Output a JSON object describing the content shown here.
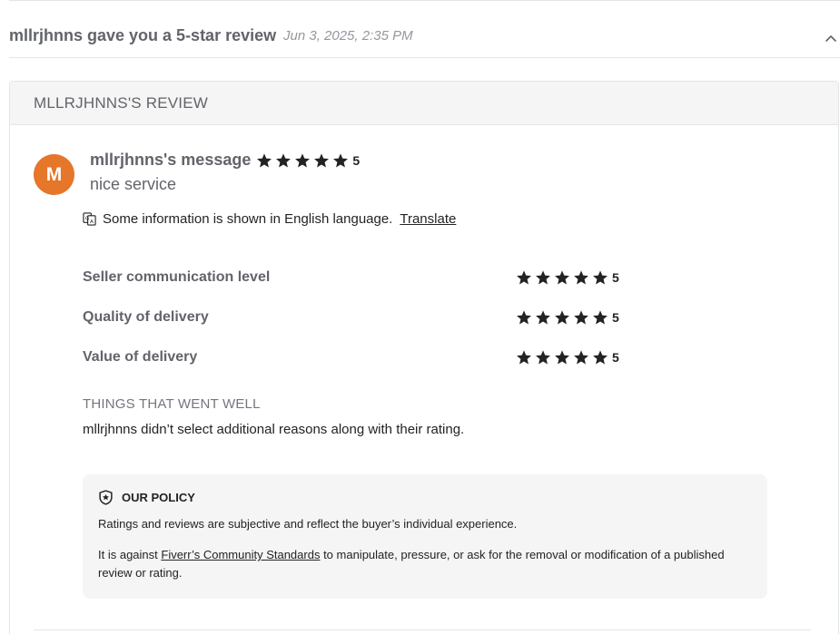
{
  "header": {
    "title": "mllrjhnns gave you a 5-star review",
    "date": "Jun 3, 2025, 2:35 PM",
    "collapse_icon": "chevron-up-icon"
  },
  "review": {
    "section_title": "MLLRJHNNS'S REVIEW",
    "avatar_initial": "M",
    "avatar_color": "#e5762a",
    "message_label": "mllrjhnns's message",
    "overall_rating": "5",
    "message_text": "nice service",
    "translate_notice": "Some information is shown in English language.",
    "translate_link": "Translate",
    "ratings": [
      {
        "label": "Seller communication level",
        "value": "5",
        "stars": 5
      },
      {
        "label": "Quality of delivery",
        "value": "5",
        "stars": 5
      },
      {
        "label": "Value of delivery",
        "value": "5",
        "stars": 5
      }
    ],
    "went_well_title": "THINGS THAT WENT WELL",
    "went_well_text": "mllrjhnns didn’t select additional reasons along with their rating."
  },
  "policy": {
    "title": "OUR POLICY",
    "p1": "Ratings and reviews are subjective and reflect the buyer’s individual experience.",
    "p2_prefix": "It is against ",
    "p2_link": "Fiverr’s Community Standards",
    "p2_suffix": " to manipulate, pressure, or ask for the removal or modification of a published review or rating."
  }
}
